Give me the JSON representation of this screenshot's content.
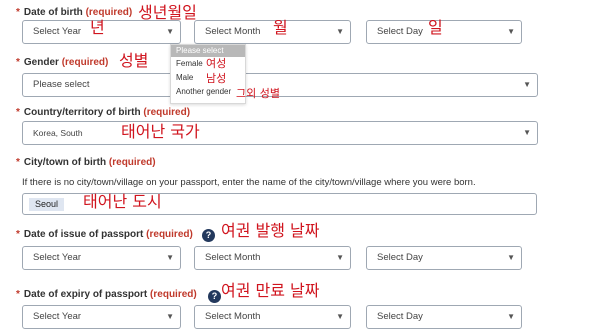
{
  "dob": {
    "label": "Date of birth",
    "required": "(required)",
    "annotation": "생년월일",
    "year": {
      "value": "Select Year",
      "annotation": "년"
    },
    "month": {
      "value": "Select Month",
      "annotation": "월"
    },
    "day": {
      "value": "Select Day",
      "annotation": "일"
    }
  },
  "gender": {
    "label": "Gender",
    "required": "(required)",
    "annotation": "성별",
    "value": "Please select",
    "options": [
      {
        "label": "Please select",
        "annotation": ""
      },
      {
        "label": "Female",
        "annotation": "여성"
      },
      {
        "label": "Male",
        "annotation": "남성"
      },
      {
        "label": "Another gender",
        "annotation": "그외 성별"
      }
    ]
  },
  "country": {
    "label": "Country/territory of birth",
    "required": "(required)",
    "value": "Korea, South",
    "annotation": "태어난 국가"
  },
  "city": {
    "label": "City/town of birth",
    "required": "(required)",
    "hint": "If there is no city/town/village on your passport, enter the name of the city/town/village where you were born.",
    "value": "Seoul",
    "annotation": "태어난 도시"
  },
  "issue": {
    "label": "Date of issue of passport",
    "required": "(required)",
    "help": "?",
    "annotation": "여권 발행 날짜",
    "year": "Select Year",
    "month": "Select Month",
    "day": "Select Day"
  },
  "expiry": {
    "label": "Date of expiry of passport",
    "required": "(required)",
    "help": "?",
    "annotation": "여권 만료 날짜",
    "year": "Select Year",
    "month": "Select Month",
    "day": "Select Day"
  },
  "icons": {
    "chevron": "chevron-down-icon",
    "help": "question-circle-icon"
  },
  "colors": {
    "required": "#c0392b",
    "annotation": "#d0141e",
    "help_icon": "#23395d",
    "selected_option": "#b8b8b8"
  }
}
